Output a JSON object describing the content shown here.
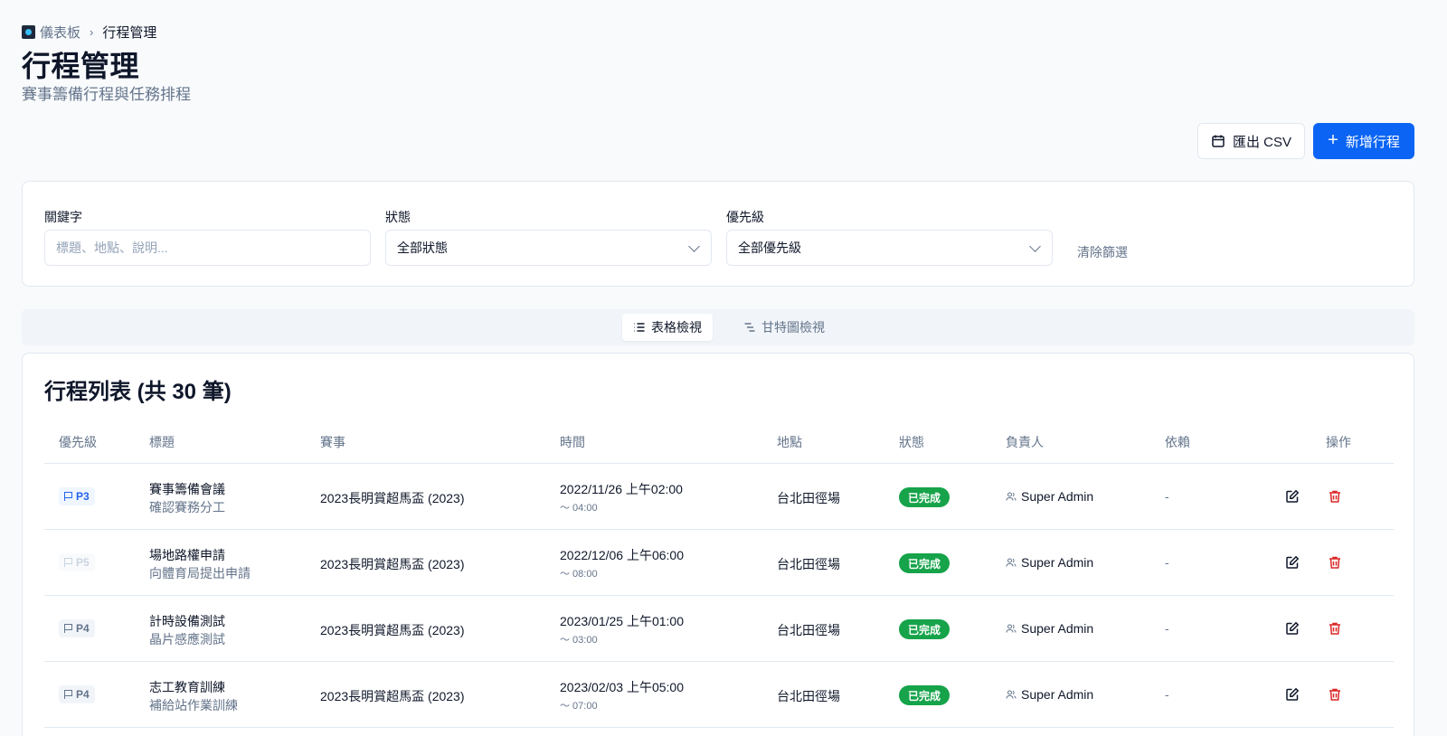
{
  "breadcrumb": {
    "parent": "儀表板",
    "current": "行程管理"
  },
  "page": {
    "title": "行程管理",
    "subtitle": "賽事籌備行程與任務排程"
  },
  "actions": {
    "export_label": "匯出 CSV",
    "add_label": "新增行程"
  },
  "filters": {
    "keyword_label": "關鍵字",
    "keyword_placeholder": "標題、地點、說明...",
    "status_label": "狀態",
    "status_value": "全部狀態",
    "priority_label": "優先級",
    "priority_value": "全部優先級",
    "clear_label": "清除篩選"
  },
  "view_toggle": {
    "table_label": "表格檢視",
    "gantt_label": "甘特圖檢視"
  },
  "list": {
    "title": "行程列表 (共 30 筆)",
    "columns": [
      "優先級",
      "標題",
      "賽事",
      "時間",
      "地點",
      "狀態",
      "負責人",
      "依賴",
      "操作"
    ],
    "rows": [
      {
        "priority": "P3",
        "title": "賽事籌備會議",
        "subtitle": "確認賽務分工",
        "event": "2023長明賞超馬盃 (2023)",
        "time": "2022/11/26 上午02:00",
        "time_end": "～ 04:00",
        "location": "台北田徑場",
        "status": "已完成",
        "owner": "Super Admin",
        "dependency": "-"
      },
      {
        "priority": "P5",
        "title": "場地路權申請",
        "subtitle": "向體育局提出申請",
        "event": "2023長明賞超馬盃 (2023)",
        "time": "2022/12/06 上午06:00",
        "time_end": "～ 08:00",
        "location": "台北田徑場",
        "status": "已完成",
        "owner": "Super Admin",
        "dependency": "-"
      },
      {
        "priority": "P4",
        "title": "計時設備測試",
        "subtitle": "晶片感應測試",
        "event": "2023長明賞超馬盃 (2023)",
        "time": "2023/01/25 上午01:00",
        "time_end": "～ 03:00",
        "location": "台北田徑場",
        "status": "已完成",
        "owner": "Super Admin",
        "dependency": "-"
      },
      {
        "priority": "P4",
        "title": "志工教育訓練",
        "subtitle": "補給站作業訓練",
        "event": "2023長明賞超馬盃 (2023)",
        "time": "2023/02/03 上午05:00",
        "time_end": "～ 07:00",
        "location": "台北田徑場",
        "status": "已完成",
        "owner": "Super Admin",
        "dependency": "-"
      }
    ]
  }
}
